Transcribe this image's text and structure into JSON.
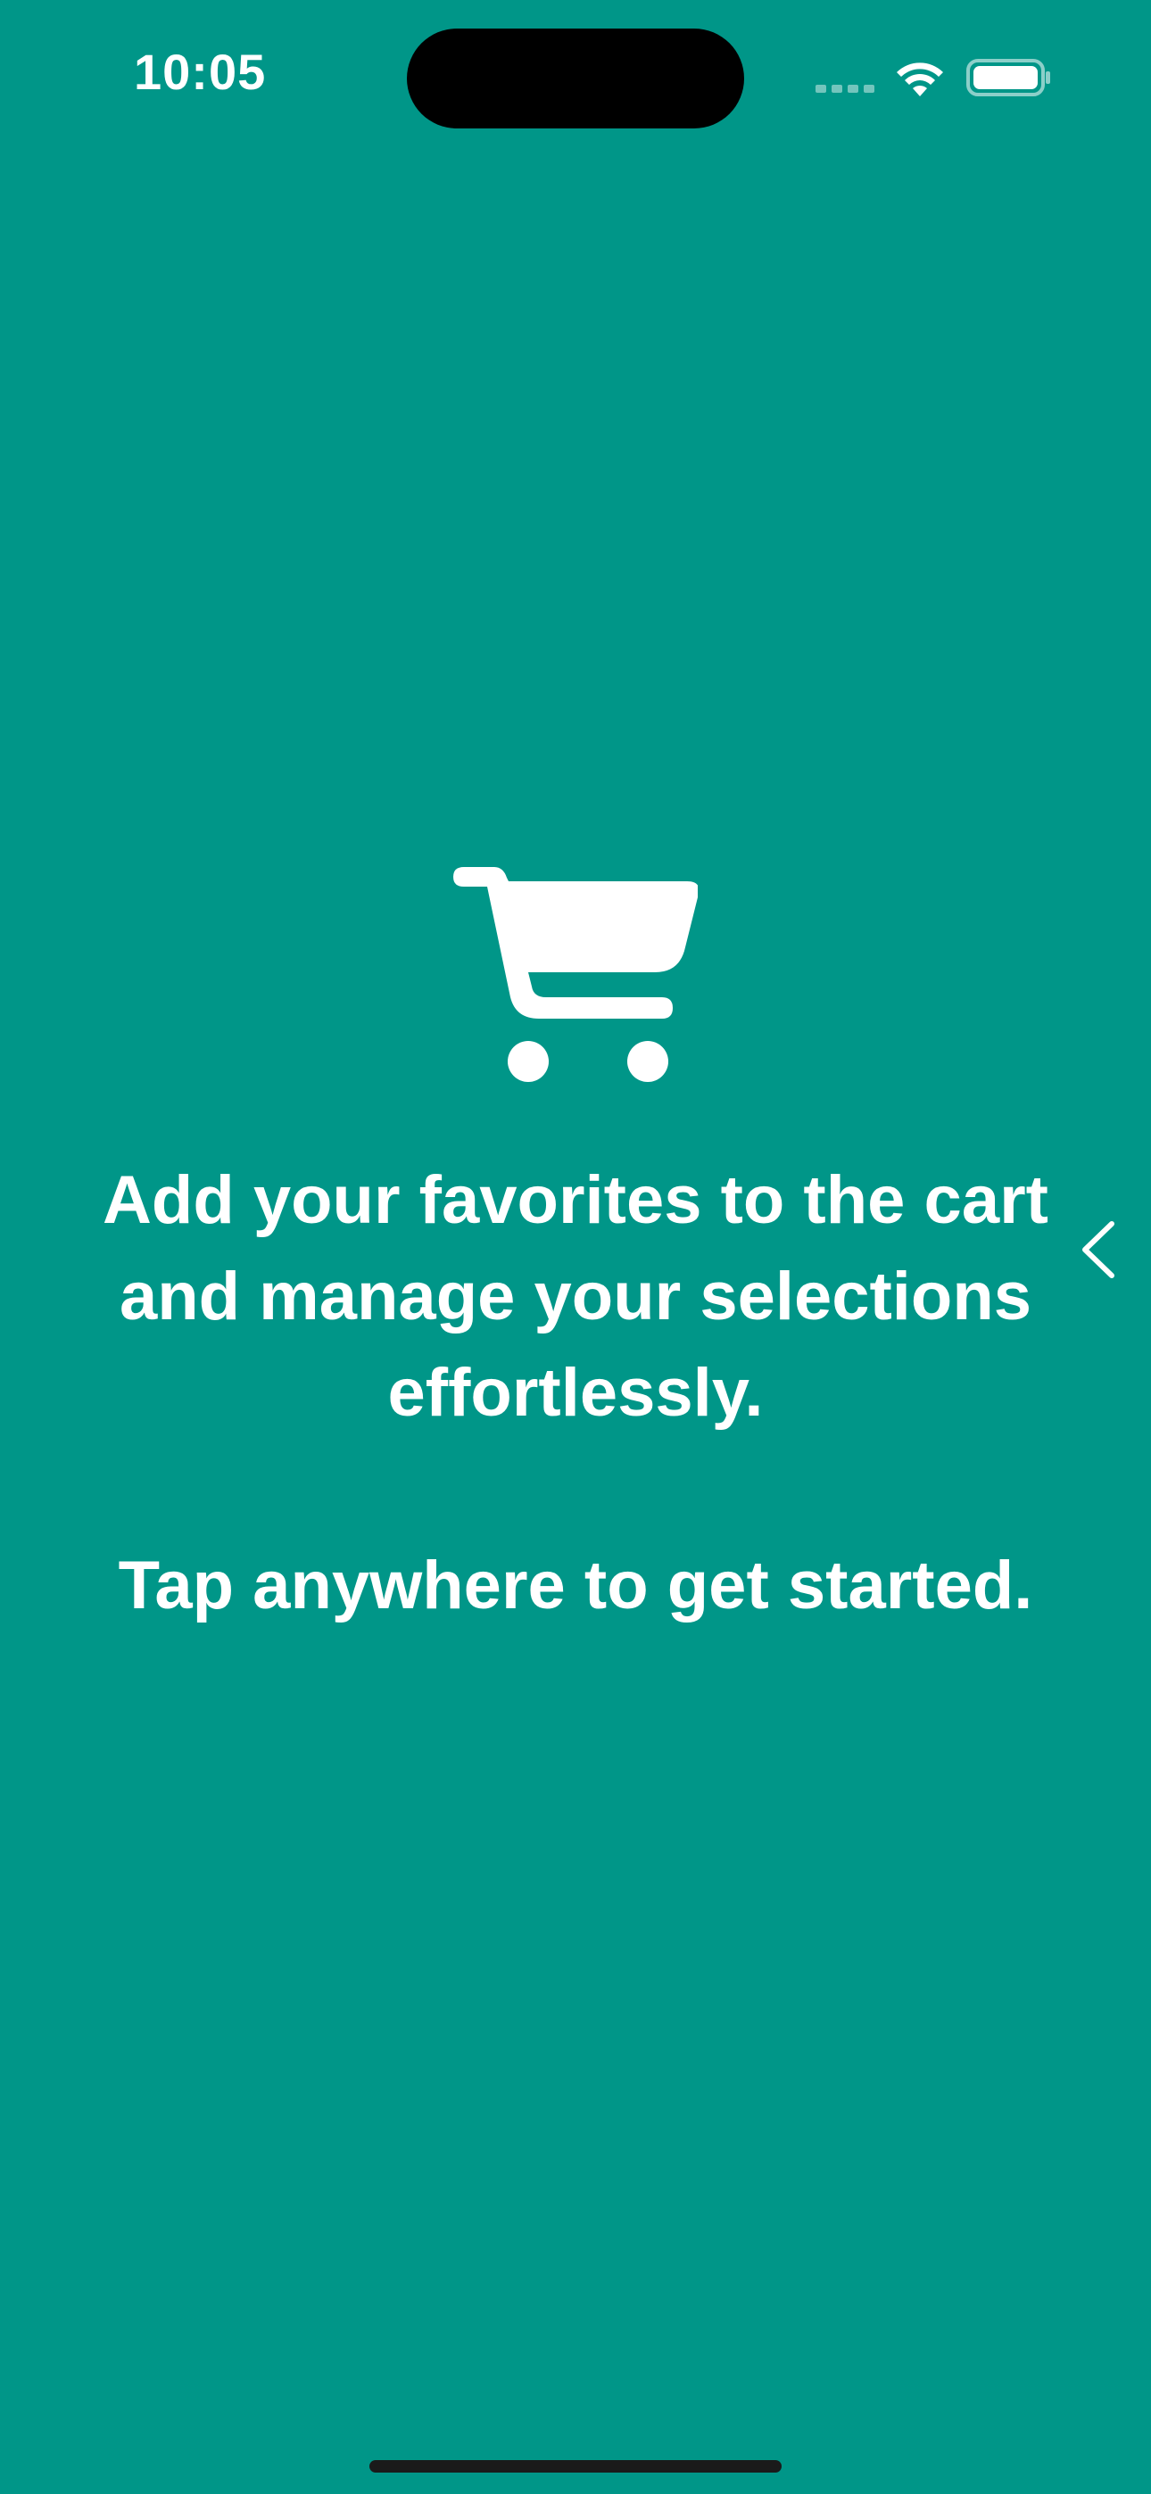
{
  "status_bar": {
    "time": "10:05"
  },
  "onboarding": {
    "icon": "shopping-cart-icon",
    "headline": "Add your favorites to the cart and manage your selections effortlessly.",
    "cta": "Tap anywhere to get started."
  },
  "navigation": {
    "back_icon": "chevron-left-icon"
  },
  "colors": {
    "background": "#009688",
    "foreground": "#FFFFFF",
    "island": "#000000"
  }
}
